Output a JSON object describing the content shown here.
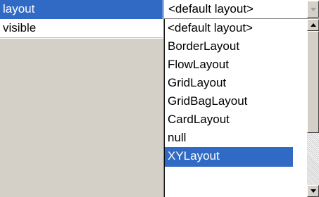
{
  "properties": [
    {
      "name": "layout",
      "selected": true
    },
    {
      "name": "visible",
      "selected": false
    }
  ],
  "combo": {
    "value": "<default layout>",
    "button_icon": "chevron-down-icon"
  },
  "dropdown": {
    "items": [
      "<default layout>",
      "BorderLayout",
      "FlowLayout",
      "GridLayout",
      "GridBagLayout",
      "CardLayout",
      "null",
      "XYLayout"
    ],
    "selected_index": 7
  },
  "colors": {
    "selection": "#316ac5",
    "panel": "#d4d0c8"
  }
}
